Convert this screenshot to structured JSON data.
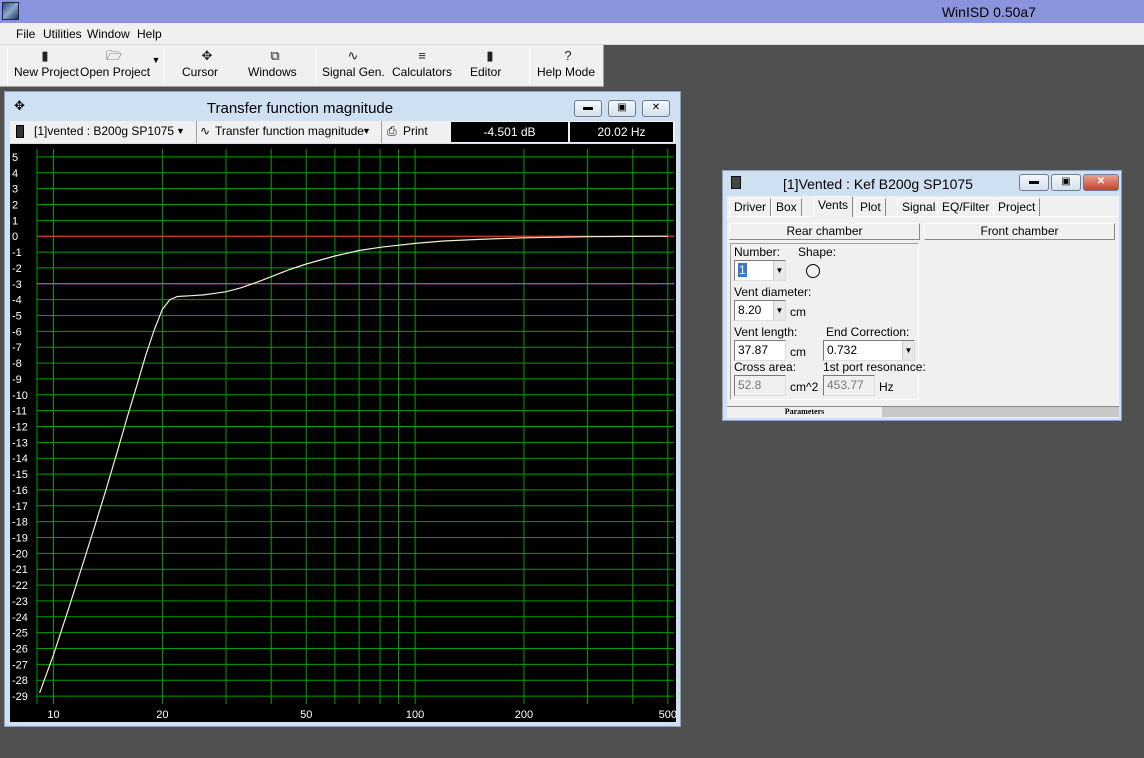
{
  "app": {
    "title": "WinISD 0.50a7"
  },
  "menu": [
    {
      "label": "File"
    },
    {
      "label": "Utilities"
    },
    {
      "label": "Window"
    },
    {
      "label": "Help"
    }
  ],
  "toolbar": {
    "new_project": "New Project",
    "open_project": "Open Project",
    "cursor": "Cursor",
    "windows": "Windows",
    "signal_gen": "Signal Gen.",
    "calculators": "Calculators",
    "editor": "Editor",
    "help_mode": "Help Mode"
  },
  "graph_window": {
    "title": "Transfer function magnitude",
    "project_select": "[1]vented : B200g SP1075",
    "graph_select": "Transfer function magnitude",
    "print_label": "Print",
    "readout_db": "-4.501 dB",
    "readout_hz": "20.02 Hz"
  },
  "chart_data": {
    "type": "line",
    "title": "Transfer function magnitude",
    "xlabel": "",
    "ylabel": "",
    "x_scale": "log",
    "xlim": [
      9,
      520
    ],
    "ylim": [
      -29.5,
      5.5
    ],
    "x_tick_labels": [
      "10",
      "20",
      "50",
      "100",
      "200",
      "500"
    ],
    "x_tick_values": [
      10,
      20,
      50,
      100,
      200,
      500
    ],
    "y_tick_labels": [
      "5",
      "4",
      "3",
      "2",
      "1",
      "0",
      "-1",
      "-2",
      "-3",
      "-4",
      "-5",
      "-6",
      "-7",
      "-8",
      "-9",
      "-10",
      "-11",
      "-12",
      "-13",
      "-14",
      "-15",
      "-16",
      "-17",
      "-18",
      "-19",
      "-20",
      "-21",
      "-22",
      "-23",
      "-24",
      "-25",
      "-26",
      "-27",
      "-28",
      "-29"
    ],
    "y_tick_values": [
      5,
      4,
      3,
      2,
      1,
      0,
      -1,
      -2,
      -3,
      -4,
      -5,
      -6,
      -7,
      -8,
      -9,
      -10,
      -11,
      -12,
      -13,
      -14,
      -15,
      -16,
      -17,
      -18,
      -19,
      -20,
      -21,
      -22,
      -23,
      -24,
      -25,
      -26,
      -27,
      -28,
      -29
    ],
    "grid": true,
    "reference_lines": [
      {
        "y": 0,
        "color": "#ff3030"
      },
      {
        "y": -3,
        "color": "#ff30ff"
      }
    ],
    "series": [
      {
        "color": "#f2f2d0",
        "x": [
          9.15,
          10,
          11,
          12,
          13,
          14,
          15,
          16,
          17,
          18,
          19,
          20,
          21,
          22,
          24,
          26,
          28,
          30,
          33,
          36,
          40,
          45,
          50,
          60,
          70,
          80,
          100,
          120,
          150,
          200,
          250,
          300,
          400,
          500
        ],
        "y": [
          -28.8,
          -26.4,
          -23.5,
          -20.8,
          -18.3,
          -15.9,
          -13.6,
          -11.4,
          -9.4,
          -7.5,
          -5.9,
          -4.6,
          -4.0,
          -3.8,
          -3.75,
          -3.7,
          -3.6,
          -3.5,
          -3.25,
          -2.95,
          -2.55,
          -2.1,
          -1.75,
          -1.25,
          -0.9,
          -0.7,
          -0.45,
          -0.3,
          -0.2,
          -0.1,
          -0.06,
          -0.03,
          -0.01,
          0.0
        ]
      }
    ]
  },
  "vent_dialog": {
    "title": "[1]Vented : Kef B200g SP1075",
    "tabs": [
      "Driver",
      "Box",
      "Vents",
      "Plot",
      "Signal",
      "EQ/Filter",
      "Project"
    ],
    "active_tab": "Vents",
    "rear_chamber": "Rear chamber",
    "front_chamber": "Front chamber",
    "number_label": "Number:",
    "number_value": "1",
    "shape_label": "Shape:",
    "vent_diameter_label": "Vent diameter:",
    "vent_diameter_value": "8.20",
    "vent_diameter_unit": "cm",
    "vent_length_label": "Vent length:",
    "vent_length_value": "37.87",
    "vent_length_unit": "cm",
    "end_correction_label": "End Correction:",
    "end_correction_value": "0.732",
    "cross_area_label": "Cross area:",
    "cross_area_value": "52.8",
    "cross_area_unit": "cm^2",
    "port_resonance_label": "1st port resonance:",
    "port_resonance_value": "453.77",
    "port_resonance_unit": "Hz",
    "status": "Parameters"
  }
}
